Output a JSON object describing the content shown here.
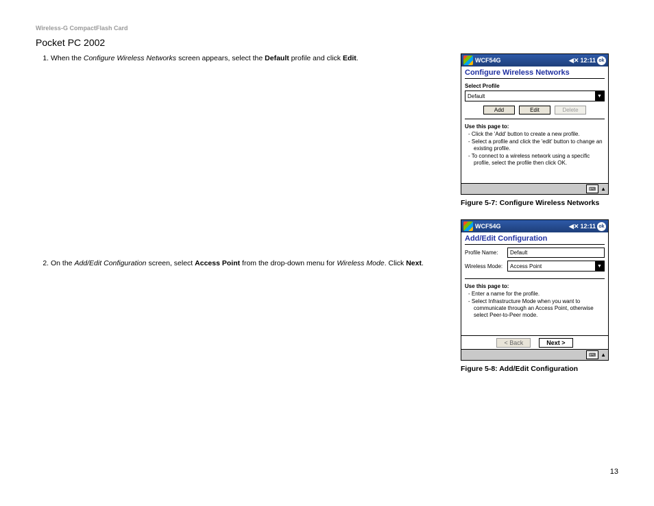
{
  "header": "Wireless-G CompactFlash Card",
  "section_title": "Pocket PC 2002",
  "steps": {
    "s1": {
      "pre": "When the ",
      "i1": "Configure Wireless Networks",
      "mid1": " screen appears, select the ",
      "b1": "Default",
      "mid2": " profile and click ",
      "b2": "Edit",
      "end": "."
    },
    "s2": {
      "pre": "On the ",
      "i1": "Add/Edit Configuration",
      "mid1": " screen, select ",
      "b1": "Access Point",
      "mid2": " from the drop-down menu for ",
      "i2": "Wireless Mode",
      "mid3": ". Click ",
      "b2": "Next",
      "end": "."
    }
  },
  "fig1": {
    "caption": "Figure 5-7: Configure Wireless Networks",
    "titlebar": {
      "app": "WCF54G",
      "time": "12:11",
      "ok": "ok",
      "speaker": "◀✕"
    },
    "heading": "Configure Wireless Networks",
    "label_select": "Select Profile",
    "select_value": "Default",
    "buttons": {
      "add": "Add",
      "edit": "Edit",
      "del": "Delete"
    },
    "help_head": "Use this page to:",
    "help_items": [
      "Click the 'Add' button to create a new profile.",
      "Select a profile and click the 'edit' button to change an existing profile.",
      "To connect to a wireless network using a specific profile, select the profile then click OK."
    ]
  },
  "fig2": {
    "caption": "Figure 5-8: Add/Edit Configuration",
    "titlebar": {
      "app": "WCF54G",
      "time": "12:11",
      "ok": "ok",
      "speaker": "◀✕"
    },
    "heading": "Add/Edit Configuration",
    "rows": {
      "profile_label": "Profile Name:",
      "profile_value": "Default",
      "mode_label": "Wireless Mode:",
      "mode_value": "Access Point"
    },
    "help_head": "Use this page to:",
    "help_items": [
      "Enter a name for the profile.",
      "Select Infrastructure Mode when you want to communicate through an Access Point, otherwise select Peer-to-Peer mode."
    ],
    "nav": {
      "back": "<  Back",
      "next": "Next  >"
    }
  },
  "page_number": "13",
  "icons": {
    "kbd": "⌨",
    "caret": "▲",
    "dropdown": "▼"
  }
}
